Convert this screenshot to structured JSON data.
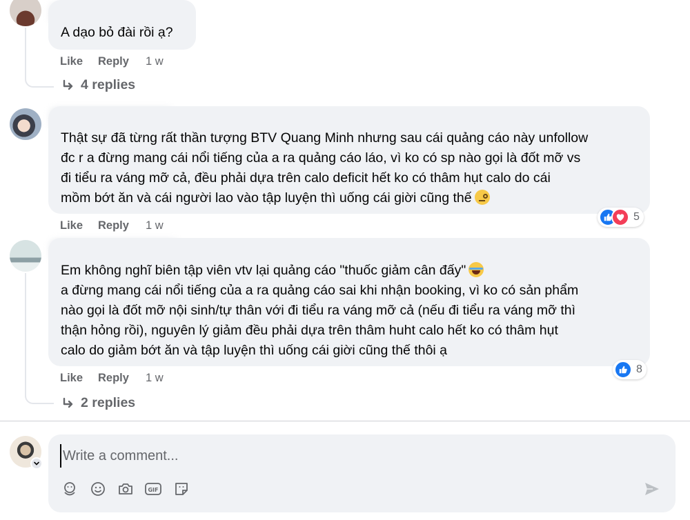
{
  "comments": [
    {
      "text_lines": [
        "A dạo bỏ đài rồi ạ?"
      ],
      "actions": {
        "like": "Like",
        "reply": "Reply",
        "time": "1 w"
      },
      "replies_label": "4 replies"
    },
    {
      "text_lines": [
        "Thật sự đã từng rất thần tượng BTV Quang Minh nhưng sau cái quảng cáo này unfollow",
        "đc r a đừng mang cái nổi tiếng của a ra quảng cáo láo, vì ko có sp nào gọi là đốt mỡ vs",
        "đi tiểu ra váng mỡ cả, đều phải dựa trên calo deficit hết ko có thâm hụt calo do cái",
        "mồm bớt ăn và cái người lao vào tập luyện thì uống cái giời cũng thế"
      ],
      "emoji": "face-with-monocle",
      "actions": {
        "like": "Like",
        "reply": "Reply",
        "time": "1 w"
      },
      "reaction_count": "5",
      "reaction_types": [
        "like",
        "love"
      ]
    },
    {
      "text_lines": [
        "Em không nghĩ biên tập viên vtv lại quảng cáo \"thuốc giảm cân đấy\"",
        "a đừng mang cái nổi tiếng của a ra quảng cáo sai khi nhận booking, vì ko có sản phẩm",
        "nào gọi là đốt mỡ nội sinh/tự thân với đi tiểu ra váng mỡ cả (nếu đi tiểu ra váng mỡ thì",
        "thận hỏng rồi), nguyên lý giảm đều phải dựa trên thâm huht calo hết ko có thâm hụt",
        "calo do giảm bớt ăn và tập luyện thì uống cái giời cũng thế thôi ạ"
      ],
      "emoji": "face-with-tears-of-joy",
      "actions": {
        "like": "Like",
        "reply": "Reply",
        "time": "1 w"
      },
      "reaction_count": "8",
      "reaction_types": [
        "like"
      ],
      "replies_label": "2 replies"
    }
  ],
  "composer": {
    "placeholder": "Write a comment...",
    "tools": [
      "avatar-sticker-icon",
      "emoji-icon",
      "camera-icon",
      "gif-icon",
      "sticker-icon"
    ],
    "send_icon": "send-icon"
  },
  "colors": {
    "bubble": "#f0f2f5",
    "secondary_text": "#65676b",
    "like_blue": "#1877f2",
    "love_red": "#f33e58"
  }
}
